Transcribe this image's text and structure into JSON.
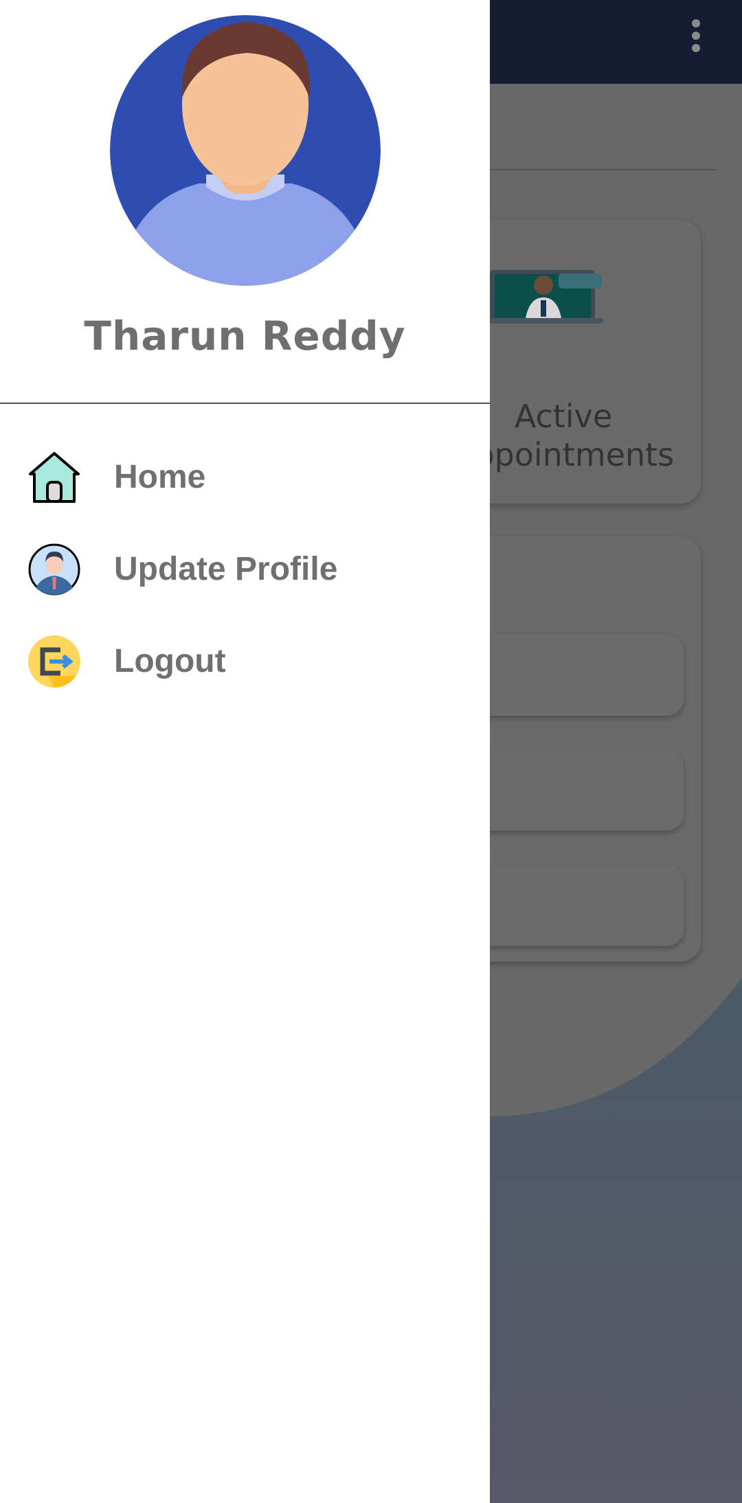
{
  "drawer": {
    "user_name": "Tharun Reddy",
    "menu": [
      {
        "label": "Home",
        "icon": "home-icon"
      },
      {
        "label": "Update Profile",
        "icon": "profile-icon"
      },
      {
        "label": "Logout",
        "icon": "logout-icon"
      }
    ]
  },
  "background": {
    "card_label_line1": "Active",
    "card_label_line2": "Appointments",
    "app_bar_color": "#161c31"
  }
}
